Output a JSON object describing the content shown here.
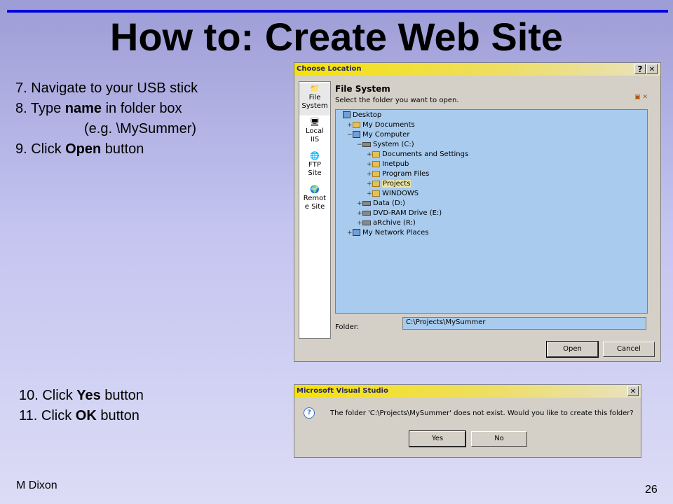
{
  "slide": {
    "title": "How to: Create Web Site",
    "steps": [
      "7. Navigate to your USB stick",
      "8. Type ",
      "name",
      " in folder box",
      "(e.g. \\MySummer)",
      "9. Click ",
      "Open",
      " button"
    ],
    "steps2": [
      "10. Click ",
      "Yes",
      " button",
      "11. Click ",
      "OK",
      " button"
    ],
    "author": "M Dixon",
    "page_number": "26"
  },
  "choose_location": {
    "title": "Choose Location",
    "help_btn": "?",
    "close_btn": "✕",
    "places": [
      {
        "label1": "File",
        "label2": "System",
        "icon": "file-system-icon"
      },
      {
        "label1": "Local",
        "label2": "IIS",
        "icon": "local-iis-icon"
      },
      {
        "label1": "FTP",
        "label2": "Site",
        "icon": "ftp-site-icon"
      },
      {
        "label1": "Remot",
        "label2": "e Site",
        "icon": "remote-site-icon"
      }
    ],
    "heading": "File System",
    "subheading": "Select the folder you want to open.",
    "tree": [
      {
        "label": "Desktop",
        "depth": 0,
        "pm": "",
        "kind": "computer"
      },
      {
        "label": "My Documents",
        "depth": 1,
        "pm": "+",
        "kind": "folder"
      },
      {
        "label": "My Computer",
        "depth": 1,
        "pm": "−",
        "kind": "computer"
      },
      {
        "label": "System (C:)",
        "depth": 2,
        "pm": "−",
        "kind": "drive"
      },
      {
        "label": "Documents and Settings",
        "depth": 3,
        "pm": "+",
        "kind": "folder"
      },
      {
        "label": "Inetpub",
        "depth": 3,
        "pm": "+",
        "kind": "folder"
      },
      {
        "label": "Program Files",
        "depth": 3,
        "pm": "+",
        "kind": "folder"
      },
      {
        "label": "Projects",
        "depth": 3,
        "pm": "+",
        "kind": "folder",
        "selected": true
      },
      {
        "label": "WINDOWS",
        "depth": 3,
        "pm": "+",
        "kind": "folder"
      },
      {
        "label": "Data (D:)",
        "depth": 2,
        "pm": "+",
        "kind": "drive"
      },
      {
        "label": "DVD-RAM Drive (E:)",
        "depth": 2,
        "pm": "+",
        "kind": "drive"
      },
      {
        "label": "aRchive (R:)",
        "depth": 2,
        "pm": "+",
        "kind": "drive"
      },
      {
        "label": "My Network Places",
        "depth": 1,
        "pm": "+",
        "kind": "computer"
      }
    ],
    "folder_label": "Folder:",
    "folder_value": "C:\\Projects\\MySummer",
    "open_btn": "Open",
    "cancel_btn": "Cancel"
  },
  "vs_dialog": {
    "title": "Microsoft Visual Studio",
    "close_btn": "✕",
    "icon_glyph": "?",
    "message": "The folder 'C:\\Projects\\MySummer' does not exist. Would you like to create this folder?",
    "yes_btn": "Yes",
    "no_btn": "No"
  }
}
